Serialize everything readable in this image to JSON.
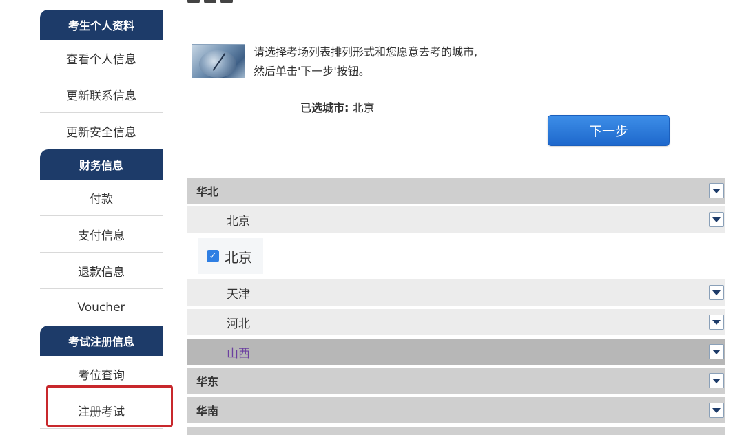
{
  "sidebar": {
    "groups": [
      {
        "header": "考生个人资料",
        "items": [
          "查看个人信息",
          "更新联系信息",
          "更新安全信息"
        ]
      },
      {
        "header": "财务信息",
        "items": [
          "付款",
          "支付信息",
          "退款信息",
          "Voucher"
        ]
      },
      {
        "header": "考试注册信息",
        "items": [
          "考位查询",
          "注册考试"
        ]
      }
    ]
  },
  "intro": {
    "line1": "请选择考场列表排列形式和您愿意去考的城市,",
    "line2": "然后单击'下一步'按钮。"
  },
  "selected_city": {
    "label": "已选城市:",
    "value": "北京"
  },
  "next_button": "下一步",
  "regions": {
    "huabei": "华北",
    "beijing_province": "北京",
    "beijing_city": "北京",
    "tianjin": "天津",
    "hebei": "河北",
    "shanxi": "山西",
    "huadong": "华东",
    "huanan": "华南"
  },
  "icons": {
    "dropdown": "chevron-down-icon",
    "checkbox": "checkmark-icon"
  },
  "colors": {
    "sidebar_header": "#1d3b69",
    "button": "#2574dc",
    "highlight": "#c8282c",
    "active_text": "#6b3fa0"
  }
}
